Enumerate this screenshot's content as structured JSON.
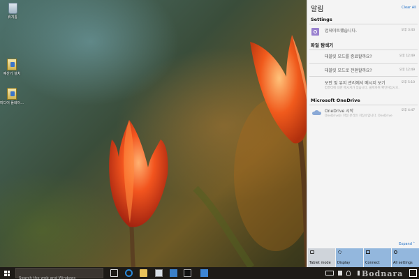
{
  "desktop": {
    "icons": [
      {
        "label": "휴지통",
        "icon": "recycle-bin-icon"
      },
      {
        "label": "예산기 설치",
        "icon": "setup-icon"
      },
      {
        "label": "미디어 플레이...",
        "icon": "setup-icon"
      }
    ]
  },
  "action_center": {
    "title": "알림",
    "clear_all": "Clear All",
    "groups": [
      {
        "name": "Settings",
        "items": [
          {
            "text": "업데이트했습니다.",
            "time": "오후 3:43"
          }
        ]
      },
      {
        "name": "파일 탐색기",
        "items": [
          {
            "text": "태블릿 모드를 종료할까요?",
            "time": "오후 12:49"
          },
          {
            "text": "태블릿 모드로 전환할까요?",
            "time": "오후 12:49"
          },
          {
            "text": "보안 및 유지 관리에서 메시지 보기",
            "sub": "컴퓨터에 대한 메시지가 있습니다. 클릭하여 확인하십시오.",
            "time": "오후 5:10"
          }
        ]
      },
      {
        "name": "Microsoft OneDrive",
        "items": [
          {
            "text": "OneDrive 시작",
            "sub": "OneDrive는 파일 온라인 저장소입니다. OneDrive",
            "time": "오후 4:47"
          }
        ]
      }
    ],
    "expand": "Expand",
    "quick_actions": [
      {
        "label": "Tablet mode",
        "icon": "tablet-icon",
        "active": false
      },
      {
        "label": "Display",
        "icon": "display-icon",
        "active": true
      },
      {
        "label": "Connect",
        "icon": "connect-icon",
        "active": true
      },
      {
        "label": "All settings",
        "icon": "gear-icon",
        "active": true
      }
    ]
  },
  "taskbar": {
    "search_placeholder": "Search the web and Windows",
    "watermark": "Bodnara"
  },
  "colors": {
    "accent_blue": "#93b7dd",
    "link_blue": "#1e6ec7",
    "taskbar": "#1e1b17",
    "panel_bg": "#f4f4f4"
  }
}
